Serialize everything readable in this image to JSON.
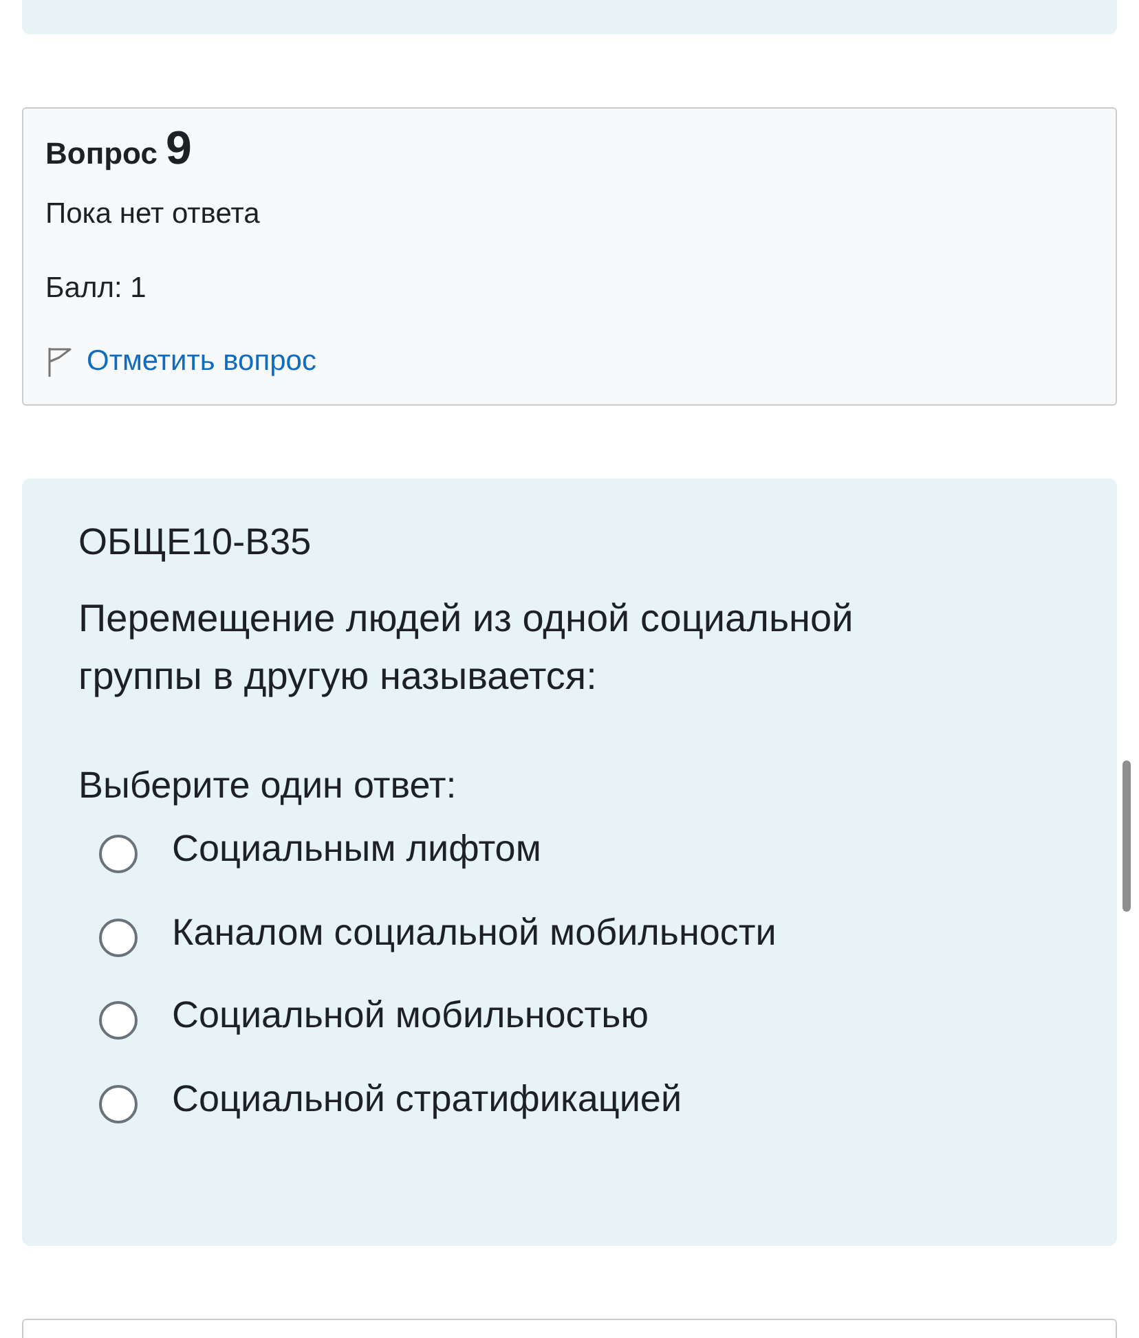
{
  "question_info": {
    "label": "Вопрос",
    "number": "9",
    "status": "Пока нет ответа",
    "grade": "Балл: 1",
    "flag_link": "Отметить вопрос"
  },
  "question": {
    "code": "ОБЩЕ10-В35",
    "text": "Перемещение людей из одной социальной группы в другую называется:",
    "prompt": "Выберите один ответ:",
    "options": [
      {
        "label": "Социальным лифтом",
        "selected": false
      },
      {
        "label": "Каналом социальной мобильности",
        "selected": false
      },
      {
        "label": "Социальной мобильностью",
        "selected": false
      },
      {
        "label": "Социальной стратификацией",
        "selected": false
      }
    ]
  }
}
